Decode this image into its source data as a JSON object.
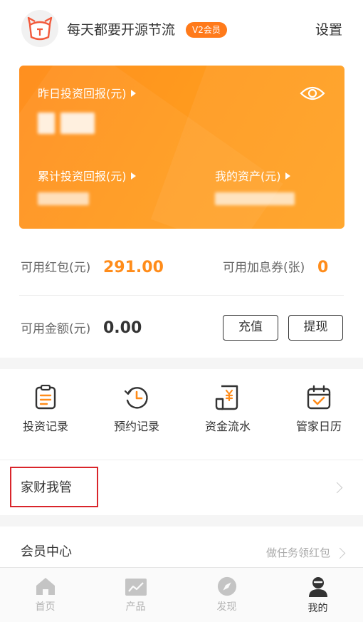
{
  "header": {
    "username": "每天都要开源节流",
    "vip_badge": "V2会员",
    "settings_label": "设置"
  },
  "card": {
    "yesterday_return_label": "昨日投资回报(元)",
    "total_return_label": "累计投资回报(元)",
    "my_assets_label": "我的资产(元)",
    "values_masked": true
  },
  "balances": {
    "red_packet_label": "可用红包(元)",
    "red_packet_value": "291.00",
    "coupon_label": "可用加息券(张)",
    "coupon_value": "0",
    "available_label": "可用金额(元)",
    "available_value": "0.00",
    "recharge_button": "充值",
    "withdraw_button": "提现"
  },
  "quick_actions": [
    {
      "label": "投资记录",
      "icon": "clipboard-icon"
    },
    {
      "label": "预约记录",
      "icon": "clock-history-icon"
    },
    {
      "label": "资金流水",
      "icon": "yuan-receipt-icon"
    },
    {
      "label": "管家日历",
      "icon": "calendar-check-icon"
    }
  ],
  "family": {
    "label": "家财我管"
  },
  "member": {
    "title": "会员中心",
    "link": "做任务领红包"
  },
  "tabbar": {
    "items": [
      {
        "label": "首页",
        "icon": "home-icon",
        "active": false
      },
      {
        "label": "产品",
        "icon": "chart-icon",
        "active": false
      },
      {
        "label": "发现",
        "icon": "compass-icon",
        "active": false
      },
      {
        "label": "我的",
        "icon": "user-icon",
        "active": true
      }
    ]
  },
  "colors": {
    "brand_orange": "#ff8c1a",
    "highlight_red": "#d9252b"
  }
}
